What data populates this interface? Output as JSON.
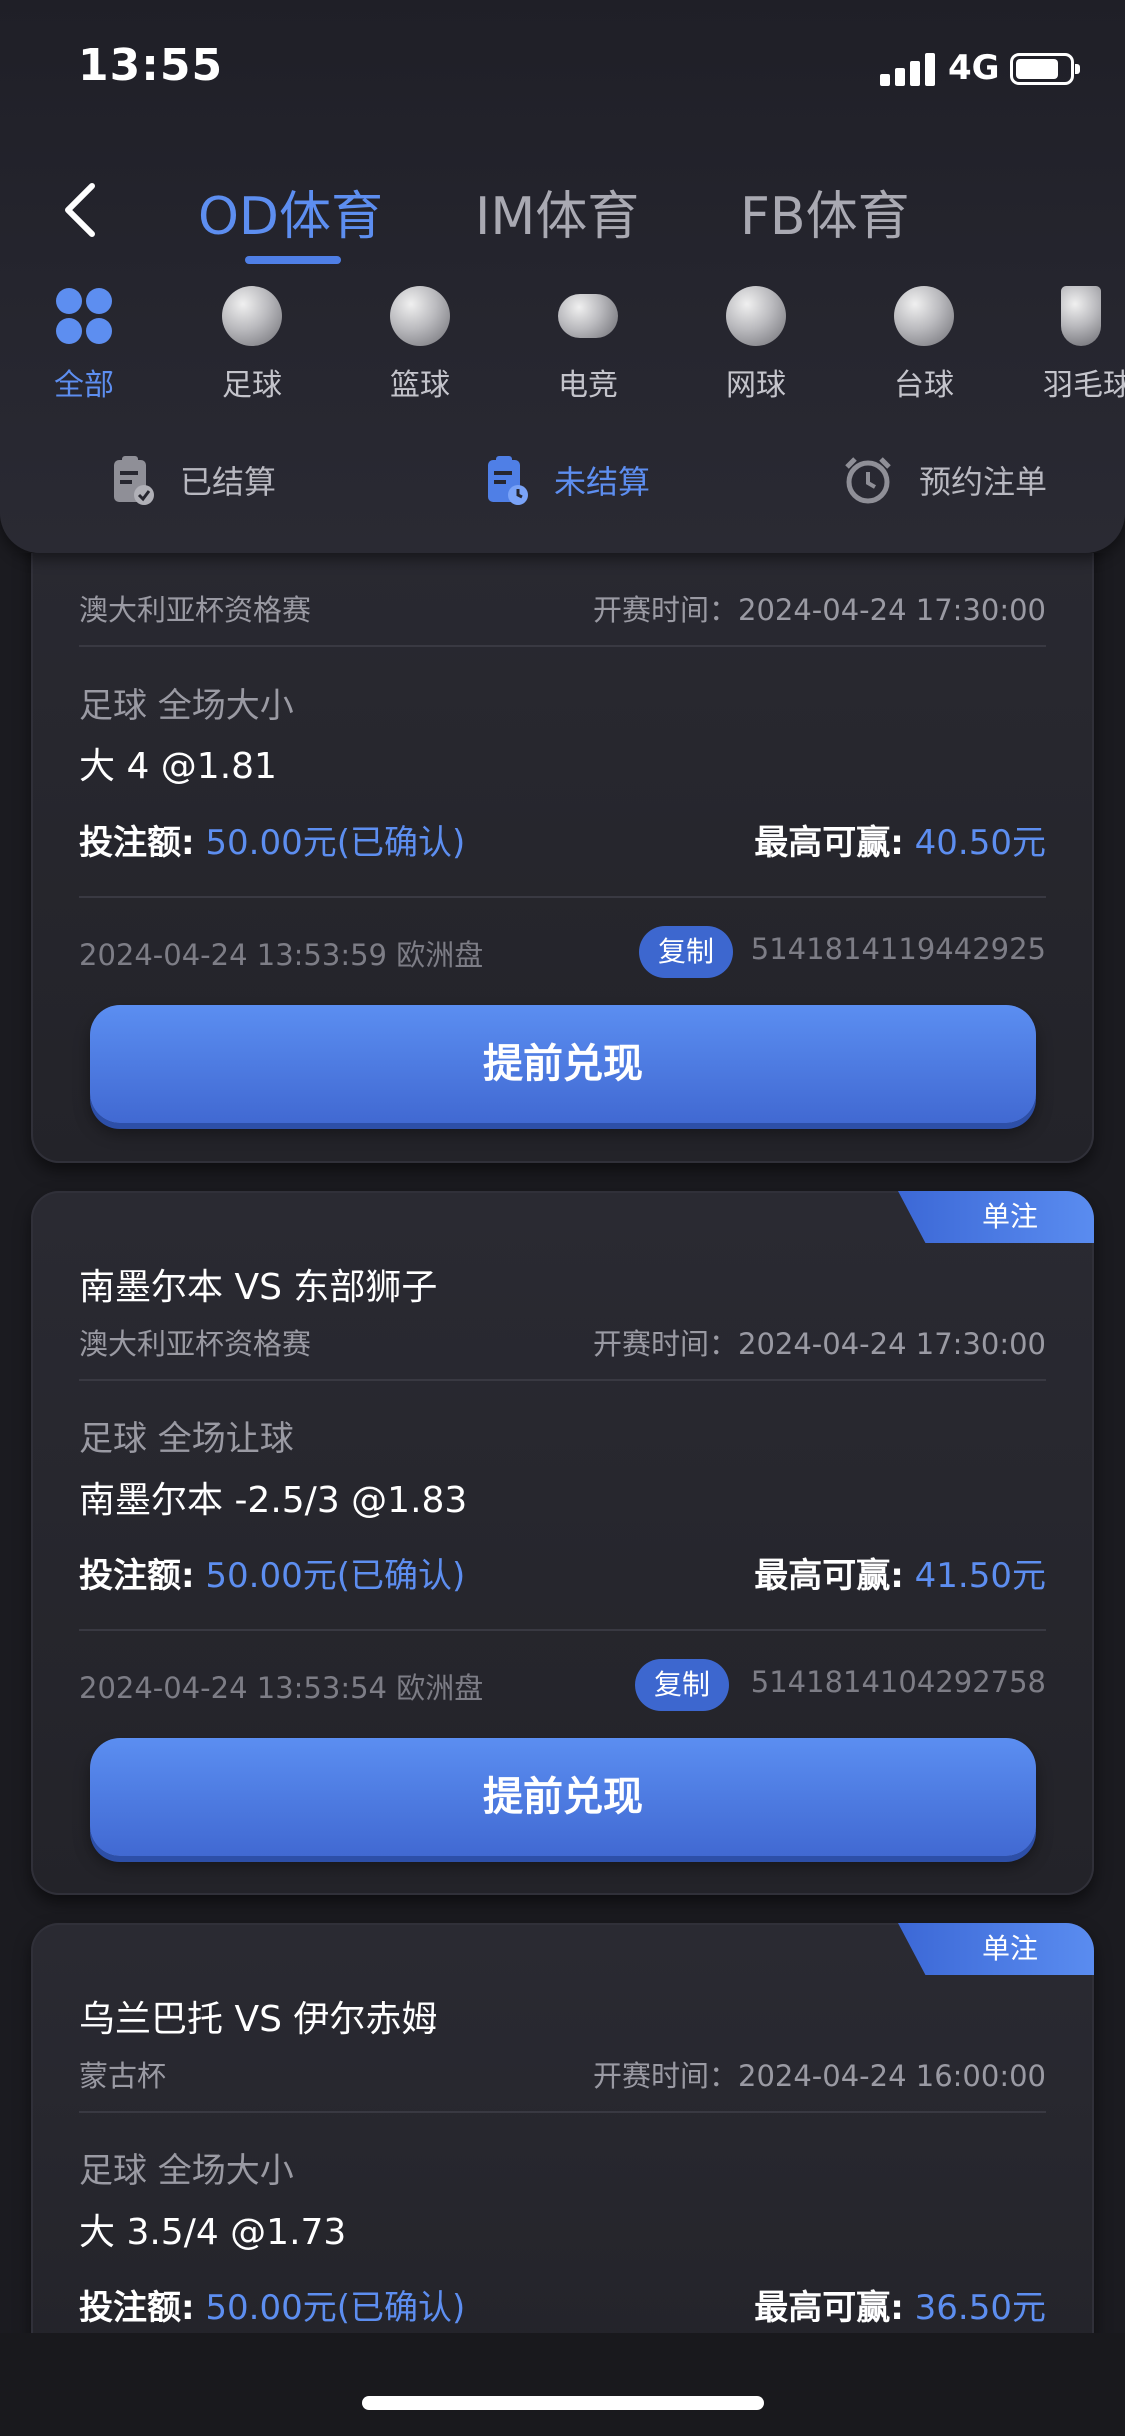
{
  "status": {
    "time": "13:55",
    "network": "4G"
  },
  "tabs": [
    {
      "label": "OD体育"
    },
    {
      "label": "IM体育"
    },
    {
      "label": "FB体育"
    }
  ],
  "categories": [
    {
      "label": "全部",
      "icon": "grid-icon"
    },
    {
      "label": "足球",
      "icon": "football-icon"
    },
    {
      "label": "篮球",
      "icon": "basketball-icon"
    },
    {
      "label": "电竞",
      "icon": "gamepad-icon"
    },
    {
      "label": "网球",
      "icon": "tennis-icon"
    },
    {
      "label": "台球",
      "icon": "billiards-icon"
    },
    {
      "label": "羽毛球",
      "icon": "shuttlecock-icon"
    }
  ],
  "subtabs": [
    {
      "label": "已结算"
    },
    {
      "label": "未结算"
    },
    {
      "label": "预约注单"
    }
  ],
  "colors": {
    "accent": "#5d8ef0",
    "button": "#4a78de"
  },
  "bets": [
    {
      "match": "",
      "league": "澳大利亚杯资格赛",
      "start_time": "开赛时间：2024-04-24 17:30:00",
      "market": "足球 全场大小",
      "pick": "大 4 @1.81",
      "stake_label": "投注额:",
      "stake_value": "50.00元(已确认)",
      "win_label": "最高可赢:",
      "win_value": "40.50元",
      "meta": "2024-04-24 13:53:59 欧洲盘",
      "copy_label": "复制",
      "order_id": "5141814119442925",
      "cashout_label": "提前兑现"
    },
    {
      "badge": "单注",
      "match": "南墨尔本 VS 东部狮子",
      "league": "澳大利亚杯资格赛",
      "start_time": "开赛时间：2024-04-24 17:30:00",
      "market": "足球 全场让球",
      "pick": "南墨尔本  -2.5/3 @1.83",
      "stake_label": "投注额:",
      "stake_value": "50.00元(已确认)",
      "win_label": "最高可赢:",
      "win_value": "41.50元",
      "meta": "2024-04-24 13:53:54 欧洲盘",
      "copy_label": "复制",
      "order_id": "5141814104292758",
      "cashout_label": "提前兑现"
    },
    {
      "badge": "单注",
      "match": "乌兰巴托 VS 伊尔赤姆",
      "league": "蒙古杯",
      "start_time": "开赛时间：2024-04-24 16:00:00",
      "market": "足球 全场大小",
      "pick": "大 3.5/4 @1.73",
      "stake_label": "投注额:",
      "stake_value": "50.00元(已确认)",
      "win_label": "最高可赢:",
      "win_value": "36.50元"
    }
  ]
}
